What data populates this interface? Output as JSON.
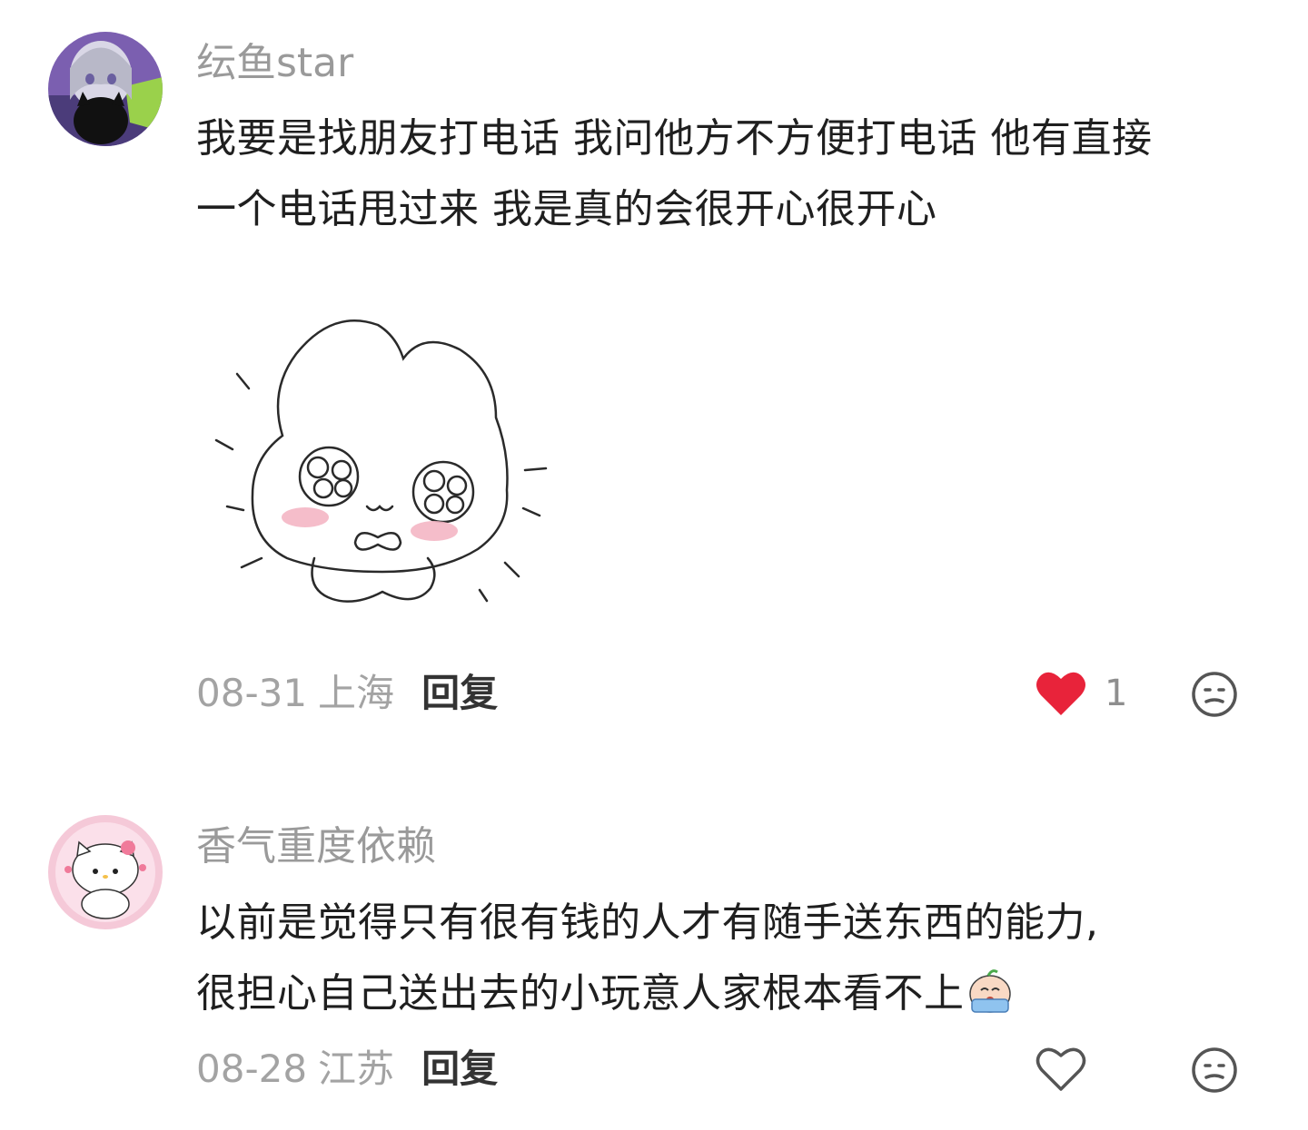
{
  "comments": [
    {
      "username": "纭鱼star",
      "text_lines": [
        "我要是找朋友打电话 我问他方不方便打电话 他有直接",
        "一个电话甩过来 我是真的会很开心很开心"
      ],
      "sticker": "doodle-bunny-sticker",
      "date": "08-31",
      "location": "上海",
      "reply_label": "回复",
      "liked": true,
      "like_count": "1",
      "like_color": "#e8233a",
      "avatar": "anime-girl-black-cat-avatar"
    },
    {
      "username": "香气重度依赖",
      "text_lines": [
        "以前是觉得只有很有钱的人才有随手送东西的能力,",
        "很担心自己送出去的小玩意人家根本看不上"
      ],
      "inline_emoji": "crying-emoji",
      "date": "08-28",
      "location": "江苏",
      "reply_label": "回复",
      "liked": false,
      "like_count": "",
      "avatar": "hello-kitty-avatar"
    }
  ]
}
